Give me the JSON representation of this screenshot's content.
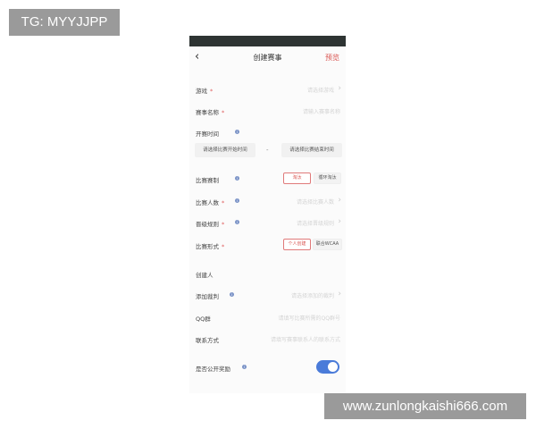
{
  "watermarks": {
    "top_left": "TG: MYYJJPP",
    "bottom_right": "www.zunlongkaishi666.com"
  },
  "colors": {
    "accent": "#d9534f",
    "toggle": "#4a7bd9",
    "info": "#7b93c7"
  },
  "nav": {
    "back_icon": "chevron-left-icon",
    "title": "创建赛事",
    "preview": "预览"
  },
  "form": {
    "game": {
      "label": "游戏",
      "placeholder": "请选择游戏"
    },
    "name": {
      "label": "赛事名称",
      "placeholder": "请输入赛事名称"
    },
    "time": {
      "label": "开赛时间",
      "start": "请选择比赛开始时间",
      "dash": "-",
      "end": "请选择比赛结束时间"
    },
    "format": {
      "label": "比赛赛制",
      "options": [
        "淘汰",
        "循环淘汰"
      ],
      "selected": 0
    },
    "players": {
      "label": "比赛人数",
      "placeholder": "请选择比赛人数"
    },
    "advance": {
      "label": "晋级规则",
      "placeholder": "请选择晋级规则"
    },
    "mode": {
      "label": "比赛形式",
      "options": [
        "个人创建",
        "联合WCAA"
      ],
      "selected": 0
    },
    "creator": {
      "label": "创建人"
    },
    "referee": {
      "label": "添加裁判",
      "placeholder": "请选择添加的裁判"
    },
    "qq": {
      "label": "QQ群",
      "placeholder": "请填写比赛所需的QQ群号"
    },
    "contact": {
      "label": "联系方式",
      "placeholder": "请填写赛事联系人的联系方式"
    },
    "public_reward": {
      "label": "是否公开奖励",
      "enabled": true
    }
  }
}
